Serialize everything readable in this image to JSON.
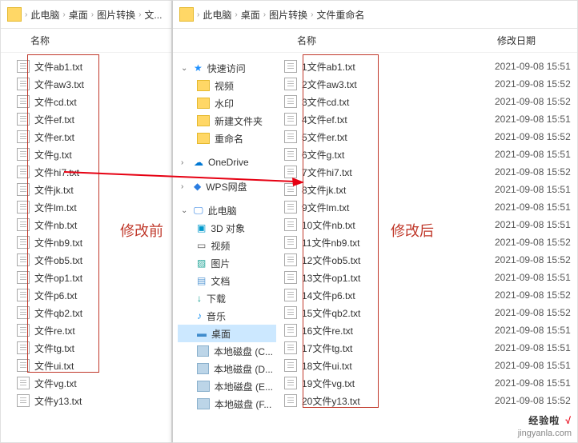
{
  "breadcrumb1": {
    "items": [
      "此电脑",
      "桌面",
      "图片转换",
      "文..."
    ]
  },
  "breadcrumb2": {
    "items": [
      "此电脑",
      "桌面",
      "图片转换",
      "文件重命名"
    ]
  },
  "headers": {
    "name": "名称",
    "date": "修改日期"
  },
  "labels": {
    "before": "修改前",
    "after": "修改后"
  },
  "tree": {
    "quick": "快速访问",
    "video": "视频",
    "watermark": "水印",
    "newfolder": "新建文件夹",
    "rename": "重命名",
    "onedrive": "OneDrive",
    "wps": "WPS网盘",
    "pc": "此电脑",
    "3d": "3D 对象",
    "videos": "视频",
    "pics": "图片",
    "docs": "文档",
    "downloads": "下载",
    "music": "音乐",
    "desktop": "桌面",
    "disk1": "本地磁盘 (C...",
    "disk2": "本地磁盘 (D...",
    "disk3": "本地磁盘 (E...",
    "disk4": "本地磁盘 (F..."
  },
  "files_before": [
    "文件ab1.txt",
    "文件aw3.txt",
    "文件cd.txt",
    "文件ef.txt",
    "文件er.txt",
    "文件g.txt",
    "文件hi7.txt",
    "文件jk.txt",
    "文件lm.txt",
    "文件nb.txt",
    "文件nb9.txt",
    "文件ob5.txt",
    "文件op1.txt",
    "文件p6.txt",
    "文件qb2.txt",
    "文件re.txt",
    "文件tg.txt",
    "文件ui.txt",
    "文件vg.txt",
    "文件y13.txt"
  ],
  "files_after": [
    "1文件ab1.txt",
    "2文件aw3.txt",
    "3文件cd.txt",
    "4文件ef.txt",
    "5文件er.txt",
    "6文件g.txt",
    "7文件hi7.txt",
    "8文件jk.txt",
    "9文件lm.txt",
    "10文件nb.txt",
    "11文件nb9.txt",
    "12文件ob5.txt",
    "13文件op1.txt",
    "14文件p6.txt",
    "15文件qb2.txt",
    "16文件re.txt",
    "17文件tg.txt",
    "18文件ui.txt",
    "19文件vg.txt",
    "20文件y13.txt"
  ],
  "dates": [
    "2021-09-08 15:51",
    "2021-09-08 15:52",
    "2021-09-08 15:52",
    "2021-09-08 15:51",
    "2021-09-08 15:52",
    "2021-09-08 15:51",
    "2021-09-08 15:52",
    "2021-09-08 15:51",
    "2021-09-08 15:51",
    "2021-09-08 15:51",
    "2021-09-08 15:52",
    "2021-09-08 15:52",
    "2021-09-08 15:51",
    "2021-09-08 15:52",
    "2021-09-08 15:52",
    "2021-09-08 15:51",
    "2021-09-08 15:51",
    "2021-09-08 15:51",
    "2021-09-08 15:51",
    "2021-09-08 15:52"
  ],
  "watermark": {
    "main": "经验啦",
    "check": "√",
    "sub": "jingyanla.com"
  }
}
